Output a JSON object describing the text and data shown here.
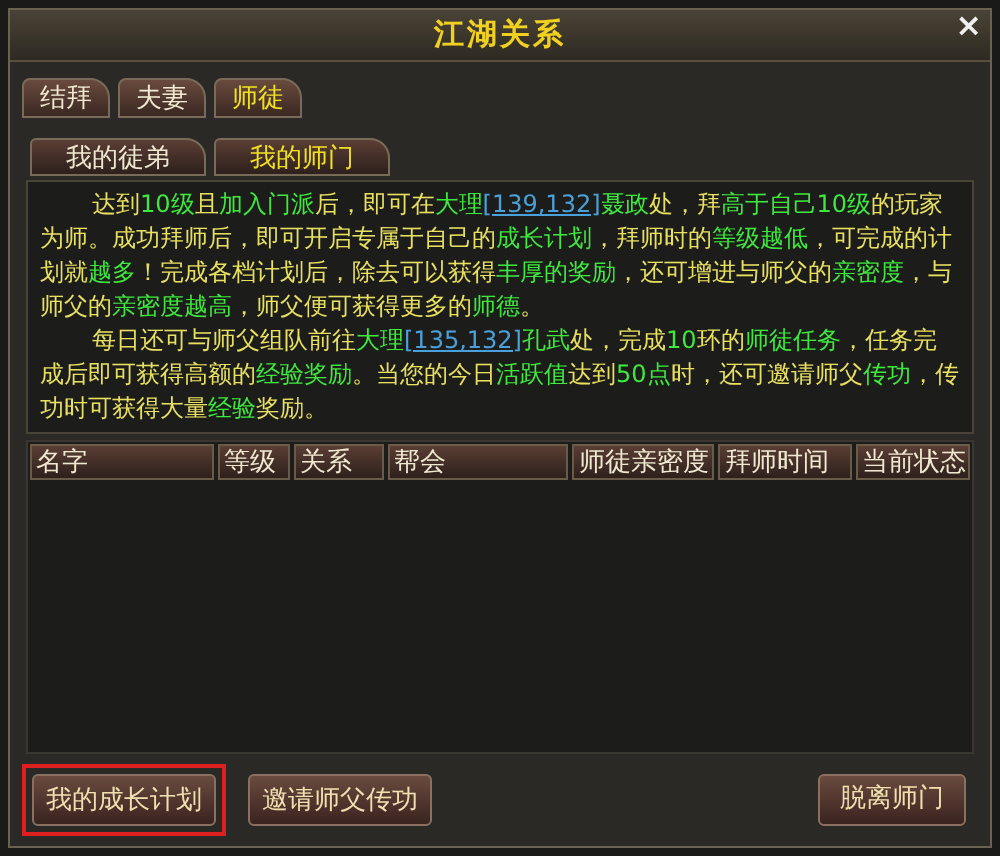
{
  "window": {
    "title": "江湖关系",
    "close_label": "×"
  },
  "tabs": [
    {
      "label": "结拜",
      "selected": false
    },
    {
      "label": "夫妻",
      "selected": false
    },
    {
      "label": "师徒",
      "selected": true
    }
  ],
  "sub_tabs": [
    {
      "label": "我的徒弟",
      "selected": false
    },
    {
      "label": "我的师门",
      "selected": true
    }
  ],
  "description": [
    [
      {
        "text": "达到",
        "kind": "plain"
      },
      {
        "text": "10级",
        "kind": "highlight"
      },
      {
        "text": "且",
        "kind": "plain"
      },
      {
        "text": "加入门派",
        "kind": "highlight"
      },
      {
        "text": "后，即可在",
        "kind": "plain"
      },
      {
        "text": "大理",
        "kind": "highlight"
      },
      {
        "text": "[139,132]",
        "kind": "link"
      },
      {
        "text": "聂政",
        "kind": "highlight"
      },
      {
        "text": "处，拜",
        "kind": "plain"
      },
      {
        "text": "高于自己10级",
        "kind": "highlight"
      },
      {
        "text": "的玩家为师。成功拜师后，即可开启专属于自己的",
        "kind": "plain"
      },
      {
        "text": "成长计划",
        "kind": "highlight"
      },
      {
        "text": "，拜师时的",
        "kind": "plain"
      },
      {
        "text": "等级越低",
        "kind": "highlight"
      },
      {
        "text": "，可完成的计划就",
        "kind": "plain"
      },
      {
        "text": "越多",
        "kind": "highlight"
      },
      {
        "text": "！完成各档计划后，除去可以获得",
        "kind": "plain"
      },
      {
        "text": "丰厚的奖励",
        "kind": "highlight"
      },
      {
        "text": "，还可增进与师父的",
        "kind": "plain"
      },
      {
        "text": "亲密度",
        "kind": "highlight"
      },
      {
        "text": "，与师父的",
        "kind": "plain"
      },
      {
        "text": "亲密度越高",
        "kind": "highlight"
      },
      {
        "text": "，师父便可获得更多的",
        "kind": "plain"
      },
      {
        "text": "师德",
        "kind": "highlight"
      },
      {
        "text": "。",
        "kind": "plain"
      }
    ],
    [
      {
        "text": "每日还可与师父组队前往",
        "kind": "plain"
      },
      {
        "text": "大理",
        "kind": "highlight"
      },
      {
        "text": "[135,132]",
        "kind": "link"
      },
      {
        "text": "孔武",
        "kind": "highlight"
      },
      {
        "text": "处，完成",
        "kind": "plain"
      },
      {
        "text": "10",
        "kind": "highlight"
      },
      {
        "text": "环的",
        "kind": "plain"
      },
      {
        "text": "师徒任务",
        "kind": "highlight"
      },
      {
        "text": "，任务完成后即可获得高额的",
        "kind": "plain"
      },
      {
        "text": "经验奖励",
        "kind": "highlight"
      },
      {
        "text": "。当您的今日",
        "kind": "plain"
      },
      {
        "text": "活跃值",
        "kind": "highlight"
      },
      {
        "text": "达到",
        "kind": "plain"
      },
      {
        "text": "50点",
        "kind": "highlight"
      },
      {
        "text": "时，还可邀请师父",
        "kind": "plain"
      },
      {
        "text": "传功",
        "kind": "highlight"
      },
      {
        "text": "，传功时可获得大量",
        "kind": "plain"
      },
      {
        "text": "经验",
        "kind": "highlight"
      },
      {
        "text": "奖励。",
        "kind": "plain"
      }
    ]
  ],
  "table": {
    "columns": [
      "名字",
      "等级",
      "关系",
      "帮会",
      "师徒亲密度",
      "拜师时间",
      "当前状态"
    ]
  },
  "buttons": [
    {
      "label": "我的成长计划",
      "highlighted": true
    },
    {
      "label": "邀请师父传功",
      "highlighted": false
    }
  ],
  "leave_button": {
    "label": "脱离师门"
  }
}
